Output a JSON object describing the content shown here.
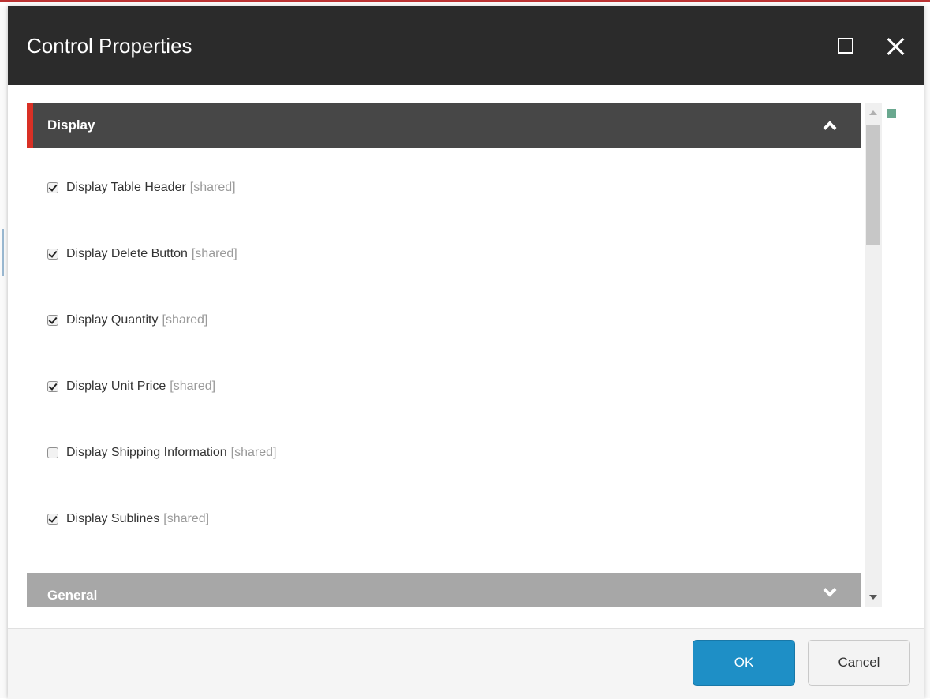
{
  "dialog": {
    "title": "Control Properties"
  },
  "sections": [
    {
      "title": "Display",
      "expanded": true,
      "fields": [
        {
          "label": "Display Table Header",
          "tag": "[shared]",
          "checked": true
        },
        {
          "label": "Display Delete Button",
          "tag": "[shared]",
          "checked": true
        },
        {
          "label": "Display Quantity",
          "tag": "[shared]",
          "checked": true
        },
        {
          "label": "Display Unit Price",
          "tag": "[shared]",
          "checked": true
        },
        {
          "label": "Display Shipping Information",
          "tag": "[shared]",
          "checked": false
        },
        {
          "label": "Display Sublines",
          "tag": "[shared]",
          "checked": true
        }
      ]
    },
    {
      "title": "General",
      "expanded": false
    }
  ],
  "footer": {
    "ok_label": "OK",
    "cancel_label": "Cancel"
  },
  "colors": {
    "titlebar": "#2b2b2b",
    "section_header_active": "#474747",
    "section_accent": "#d93025",
    "section_header_collapsed": "#a7a7a7",
    "primary_button": "#1e8fc6"
  }
}
